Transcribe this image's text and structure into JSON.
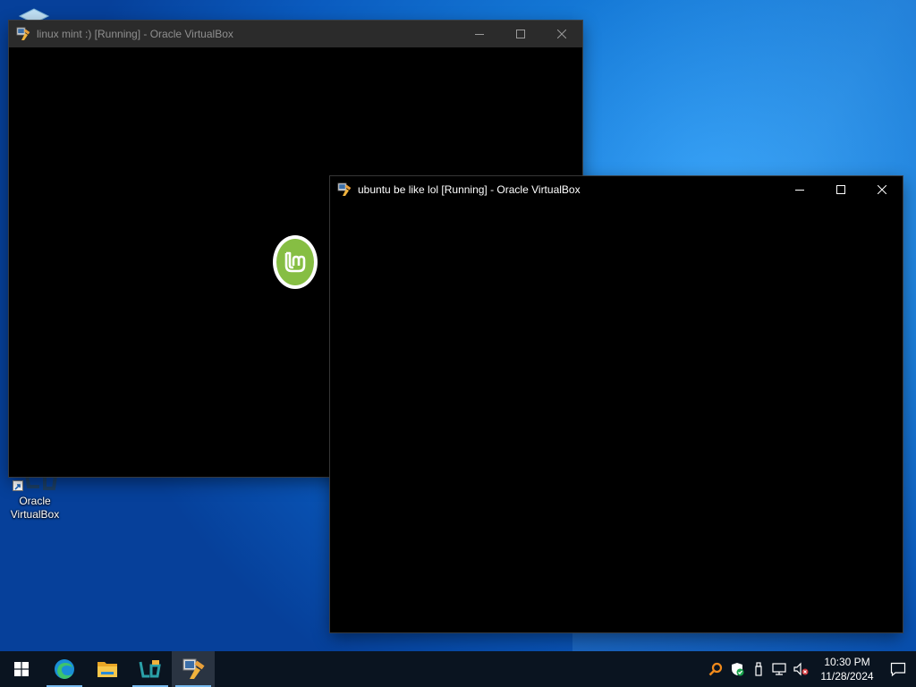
{
  "desktop": {
    "icons": [
      {
        "name": "recycle-bin",
        "label": ""
      },
      {
        "name": "oracle-virtualbox",
        "label_line1": "Oracle",
        "label_line2": "VirtualBox"
      }
    ]
  },
  "windows": [
    {
      "id": "linux-mint",
      "title": "linux mint :) [Running] - Oracle VirtualBox",
      "state": "inactive",
      "guest_screen": "mint-boot-logo"
    },
    {
      "id": "ubuntu",
      "title": "ubuntu be like lol [Running] - Oracle VirtualBox",
      "state": "active",
      "guest_screen": "blank"
    }
  ],
  "taskbar": {
    "pinned": [
      {
        "name": "start",
        "icon": "windows-logo-icon"
      },
      {
        "name": "edge",
        "icon": "edge-icon"
      },
      {
        "name": "file-explorer",
        "icon": "folder-icon"
      },
      {
        "name": "virtualbox-manager",
        "icon": "virtualbox-manager-icon"
      },
      {
        "name": "virtualbox-vm",
        "icon": "virtualbox-vm-icon"
      }
    ],
    "tray_icons": [
      "sound-search-icon",
      "security-shield-icon",
      "usb-device-icon",
      "network-icon",
      "volume-muted-icon"
    ],
    "clock": {
      "time": "10:30 PM",
      "date": "11/28/2024"
    }
  },
  "colors": {
    "accent": "#76b9ed",
    "mint_green": "#86be43",
    "taskbar_bg": "#0a1420"
  }
}
